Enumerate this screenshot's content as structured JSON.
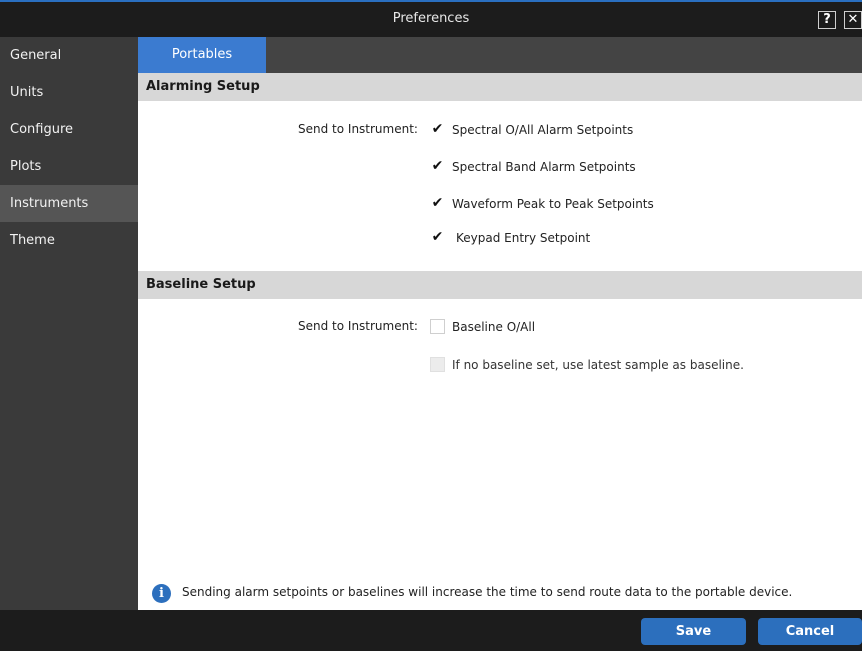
{
  "window": {
    "title": "Preferences",
    "help_label": "?",
    "close_label": "✕"
  },
  "sidebar": {
    "items": [
      {
        "label": "General"
      },
      {
        "label": "Units"
      },
      {
        "label": "Configure"
      },
      {
        "label": "Plots"
      },
      {
        "label": "Instruments",
        "active": true
      },
      {
        "label": "Theme"
      }
    ]
  },
  "tabs": [
    {
      "label": "Portables",
      "active": true
    }
  ],
  "alarming": {
    "header": "Alarming Setup",
    "send_label": "Send to Instrument:",
    "options": [
      {
        "label": "Spectral O/All Alarm Setpoints",
        "checked": true
      },
      {
        "label": "Spectral Band Alarm Setpoints",
        "checked": true
      },
      {
        "label": "Waveform Peak to Peak Setpoints",
        "checked": true
      },
      {
        "label": "Keypad Entry Setpoint",
        "checked": true
      }
    ]
  },
  "baseline": {
    "header": "Baseline Setup",
    "send_label": "Send to Instrument:",
    "options": [
      {
        "label": "Baseline O/All",
        "checked": false
      },
      {
        "label": "If no baseline set, use latest sample as baseline.",
        "checked": false,
        "disabled": true
      }
    ]
  },
  "info": {
    "icon": "info-icon",
    "text": "Sending alarm setpoints or baselines will increase the time to send route data to the portable device."
  },
  "footer": {
    "save_label": "Save",
    "cancel_label": "Cancel"
  },
  "colors": {
    "accent": "#2c6fbd",
    "tab": "#3b7bd0",
    "sidebar": "#3a3a3a",
    "sidebar_active": "#555555",
    "section": "#d7d7d7"
  }
}
